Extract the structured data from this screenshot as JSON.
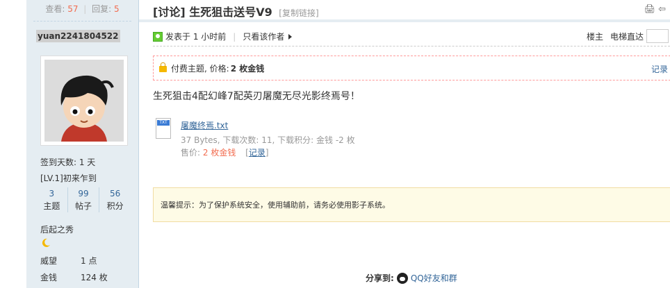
{
  "sidebar": {
    "views_label": "查看:",
    "views": "57",
    "replies_label": "回复:",
    "replies": "5",
    "username": "yuan2241804522",
    "checkin": "签到天数: 1 天",
    "level": "[LV.1]初来乍到",
    "stats": [
      {
        "value": "3",
        "label": "主题"
      },
      {
        "value": "99",
        "label": "帖子"
      },
      {
        "value": "56",
        "label": "积分"
      }
    ],
    "rank_title": "后起之秀",
    "rows": [
      {
        "key": "威望",
        "value": "1 点"
      },
      {
        "key": "金钱",
        "value": "124 枚"
      }
    ]
  },
  "post": {
    "title": "[讨论] 生死狙击送号V9",
    "copy_link": "[复制链接]",
    "posted": "发表于 1 小时前",
    "only_author": "只看该作者",
    "op_label": "楼主",
    "jump_label": "电梯直达",
    "paid_label": "付费主题, 价格:",
    "paid_price": "2 枚金钱",
    "paid_record": "记录",
    "body": "生死狙击4配幻峰7配英刃屠魔无尽光影终焉号！",
    "attachment": {
      "badge": "TXT",
      "name": "屠魔终焉.txt",
      "info": "37 Bytes, 下载次数: 11, 下载积分: 金钱 -2 枚",
      "price_label": "售价:",
      "price": "2 枚金钱",
      "record": "记录"
    },
    "notice": "温馨提示：为了保护系统安全，使用辅助前，请务必使用影子系统。",
    "share_label": "分享到:",
    "share_qq": "QQ好友和群"
  },
  "colors": {
    "sidebar_bg": "#e5edf2",
    "accent_red": "#f26c4f",
    "link_blue": "#336699",
    "notice_bg": "#fefbe6"
  }
}
